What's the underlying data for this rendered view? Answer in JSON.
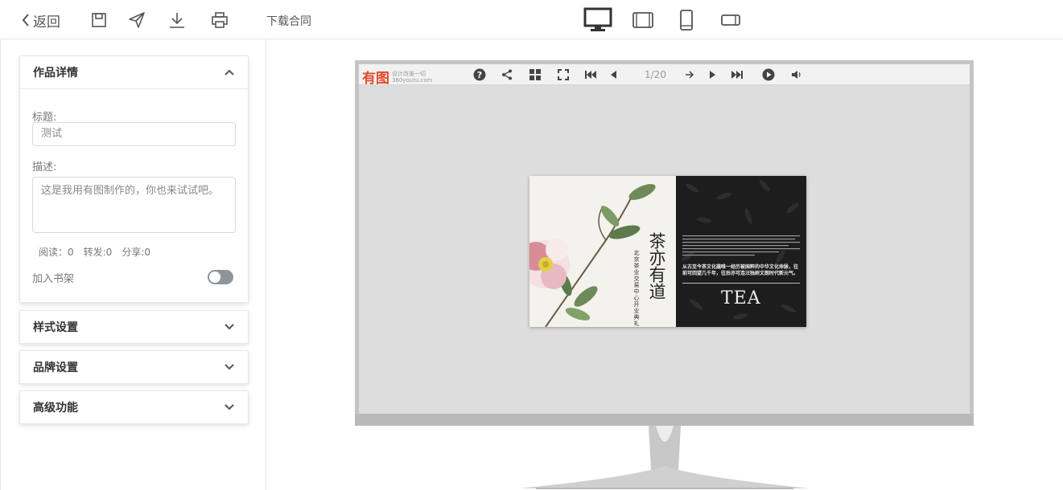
{
  "topbar": {
    "back_label": "返回",
    "download_contract": "下载合同"
  },
  "sidebar": {
    "details": {
      "title": "作品详情",
      "title_label": "标题:",
      "title_value": "测试",
      "desc_label": "描述:",
      "desc_value": "这是我用有图制作的，你也来试试吧。",
      "stats": [
        "阅读：0",
        "转发:0",
        "分享:0"
      ],
      "shelf_label": "加入书架",
      "shelf_enabled": false
    },
    "sections": [
      {
        "title": "样式设置"
      },
      {
        "title": "品牌设置"
      },
      {
        "title": "高级功能"
      }
    ]
  },
  "player": {
    "logo_mark": "有图",
    "logo_tagline": "设计改善一切",
    "logo_domain": "360youtu.com",
    "page_indicator": "1/20"
  },
  "book": {
    "left_title": "茶亦有道",
    "left_subtitle": "北京茶业交易中心开业典礼",
    "right_text": "从古至今茶文化蕴唯一经历被国粹的中华文化命脉，往前可回望几千年，往后亦可连汪独树文朗时代新元气。",
    "right_word": "TEA"
  },
  "colors": {
    "accent_logo": "#e04a2a",
    "toggle_off": "#8e959b",
    "monitor_frame": "#c4c4c4"
  }
}
